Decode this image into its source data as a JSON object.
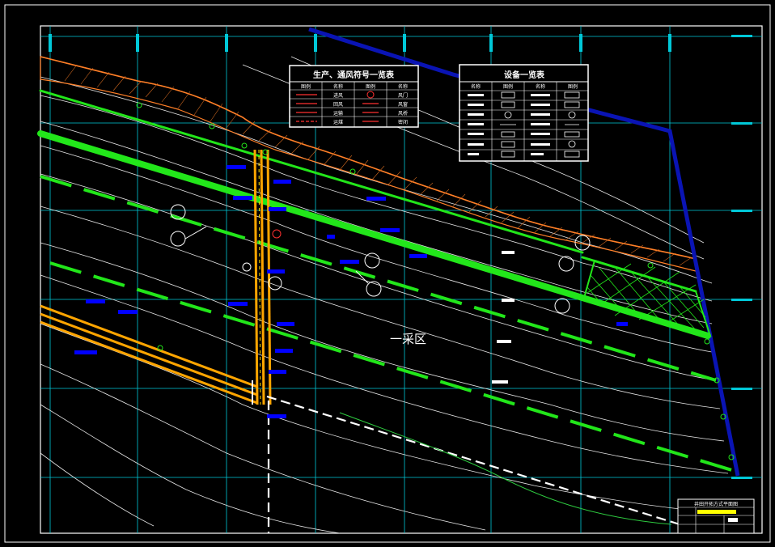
{
  "drawing": {
    "zone_label": "一采区",
    "colors": {
      "background": "#000000",
      "frame": "#ffffff",
      "grid": "#00c8d8",
      "contour": "#e6e6e6",
      "outcrop": "#ff7f27",
      "roadway_main": "#22e61a",
      "roadway_dash": "#22e61a",
      "shaft_road": "#ffa500",
      "boundary": "#0a14b4",
      "block": "#0000ff",
      "dashed_road": "#ffffff",
      "stream": "#2ecc40"
    }
  },
  "legend_production": {
    "title": "生产、通风符号一览表",
    "headers": [
      "图例",
      "名称",
      "图例",
      "名称"
    ],
    "rows": [
      [
        "",
        "进风",
        "",
        "风门"
      ],
      [
        "",
        "回风",
        "",
        "风窗"
      ],
      [
        "",
        "运输",
        "",
        "风桥"
      ],
      [
        "",
        "运煤",
        "",
        "密闭"
      ]
    ]
  },
  "legend_equipment": {
    "title": "设备一览表",
    "headers": [
      "名称",
      "图例",
      "名称",
      "图例"
    ]
  },
  "title_block": {
    "caption": "井田开拓方式平面图"
  }
}
